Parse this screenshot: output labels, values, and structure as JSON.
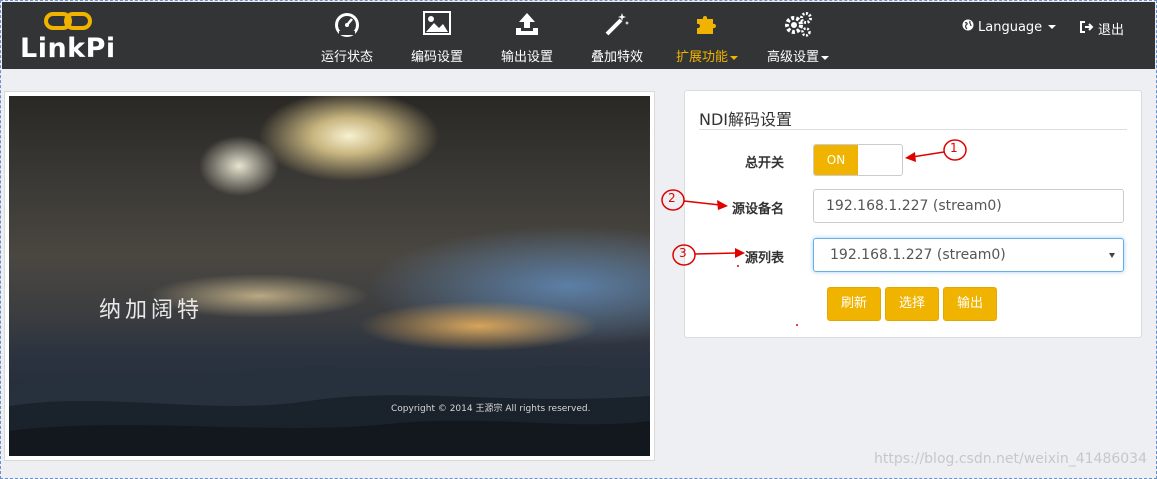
{
  "brand": {
    "name": "LinkPi"
  },
  "nav": [
    {
      "label": "运行状态",
      "icon": "dashboard-icon"
    },
    {
      "label": "编码设置",
      "icon": "image-icon"
    },
    {
      "label": "输出设置",
      "icon": "upload-icon"
    },
    {
      "label": "叠加特效",
      "icon": "magic-wand-icon"
    },
    {
      "label": "扩展功能",
      "icon": "puzzle-icon",
      "active": true,
      "dropdown": true
    },
    {
      "label": "高级设置",
      "icon": "gears-icon",
      "dropdown": true
    }
  ],
  "topbar": {
    "language_label": "Language",
    "logout_label": "退出"
  },
  "preview": {
    "caption": "纳加阔特",
    "copyright": "Copyright © 2014 王源宗  All rights reserved."
  },
  "ndi": {
    "title": "NDI解码设置",
    "switch_label": "总开关",
    "switch_state": "ON",
    "source_name_label": "源设备名",
    "source_name_value": "192.168.1.227 (stream0)",
    "source_list_label": "源列表",
    "source_list_selected": "192.168.1.227 (stream0)",
    "buttons": {
      "refresh": "刷新",
      "select": "选择",
      "output": "输出"
    }
  },
  "annotations": {
    "n1": "1",
    "n2": "2",
    "n3": "3"
  },
  "colors": {
    "accent": "#f0b400",
    "navbar": "#333436",
    "annotation": "#e00000"
  },
  "watermark": "https://blog.csdn.net/weixin_41486034"
}
